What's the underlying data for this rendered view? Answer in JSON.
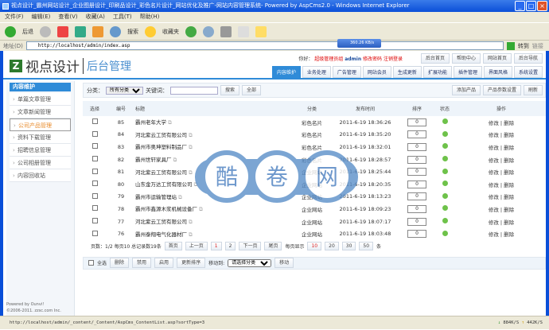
{
  "window": {
    "title": "视点设计_霸州网站设计_企业图册设计_印刷品设计_彩色名片设计_网站优化及推广-网站内容管理系统- Powered by AspCms2.0 - Windows Internet Explorer"
  },
  "menu": [
    "文件(F)",
    "编辑(E)",
    "查看(V)",
    "收藏(A)",
    "工具(T)",
    "帮助(H)"
  ],
  "toolbar": {
    "back": "后退",
    "search": "搜索",
    "favorites": "收藏夹"
  },
  "address": {
    "label": "地址(D)",
    "url": "http://localhost/admin/index.asp",
    "go": "转到",
    "links": "链接",
    "speed": "360.26 KB/s"
  },
  "header": {
    "logo": "视点设计",
    "logo_sub": "后台管理",
    "greeting": "你好：",
    "role": "超级管理员组",
    "user": "admin",
    "change_pwd": "修改密码",
    "logout": "注销登录",
    "top_buttons": [
      "后台首页",
      "帮助中心",
      "网站首页",
      "后台导航"
    ],
    "tabs": [
      "内容维护",
      "业务处理",
      "广告管理",
      "网站会员",
      "生成更新",
      "扩展功能",
      "插件管理",
      "界面风格",
      "系统设置"
    ]
  },
  "sidebar": {
    "title": "内容维护",
    "items": [
      "单篇文章管理",
      "文章新闻管理",
      "公司产品管理",
      "资料下载管理",
      "招聘信息管理",
      "公司相册管理",
      "内容回收站"
    ],
    "footer1": "Powered by Ounvi!",
    "footer2": "©2006-2011. zzsc.com Inc."
  },
  "filter": {
    "category_label": "分类：",
    "category_value": "所有分类",
    "keyword_label": "关键词：",
    "keyword_value": "",
    "search": "搜索",
    "all": "全部",
    "add": "添加产品",
    "params": "产品参数设置",
    "refresh": "刷新"
  },
  "table": {
    "headers": [
      "选择",
      "编号",
      "标题",
      "分类",
      "发布时间",
      "排序",
      "状态",
      "操作"
    ],
    "rows": [
      {
        "id": "85",
        "title": "霸州老年大学",
        "cat": "彩色名片",
        "time": "2011-6-19 18:36:26",
        "order": "0"
      },
      {
        "id": "84",
        "title": "河北紫云工贸有限公司",
        "cat": "彩色名片",
        "time": "2011-6-19 18:35:20",
        "order": "0"
      },
      {
        "id": "83",
        "title": "霸州市奥坤塑料制品厂",
        "cat": "彩色名片",
        "time": "2011-6-19 18:32:01",
        "order": "0"
      },
      {
        "id": "82",
        "title": "霸州世轩家具厂",
        "cat": "彩色名片",
        "time": "2011-6-19 18:28:57",
        "order": "0"
      },
      {
        "id": "81",
        "title": "河北紫云工贸有限公司",
        "cat": "企业网站",
        "time": "2011-6-19 18:25:44",
        "order": "0"
      },
      {
        "id": "80",
        "title": "山东金万达工贸有限公司",
        "cat": "企业网站",
        "time": "2011-6-19 18:20:35",
        "order": "0"
      },
      {
        "id": "79",
        "title": "霸州市运输管理站",
        "cat": "企业网站",
        "time": "2011-6-19 18:13:23",
        "order": "0"
      },
      {
        "id": "78",
        "title": "霸州市鑫源木浆机械设备厂",
        "cat": "企业网站",
        "time": "2011-6-19 18:09:23",
        "order": "0"
      },
      {
        "id": "77",
        "title": "河北紫云工贸有限公司",
        "cat": "企业网站",
        "time": "2011-6-19 18:07:17",
        "order": "0"
      },
      {
        "id": "76",
        "title": "霸州泰翔电气化器材厂",
        "cat": "企业网站",
        "time": "2011-6-19 18:03:48",
        "order": "0"
      }
    ],
    "edit": "修改",
    "delete": "删除"
  },
  "pager": {
    "info": "页数：1/2 每页10 总记录数19条",
    "first": "首页",
    "prev": "上一页",
    "pages": [
      "1",
      "2"
    ],
    "next": "下一页",
    "last": "尾页",
    "per_label": "每页显示",
    "per": [
      "10",
      "20",
      "30",
      "50"
    ],
    "unit": "条"
  },
  "bulk": {
    "select_all": "全选",
    "delete": "删除",
    "disable": "禁用",
    "enable": "启用",
    "update_order": "更新排序",
    "move_to": "移动到:",
    "move_select": "请选择分类",
    "move": "移动"
  },
  "watermark": "酷卷网",
  "status": {
    "url": "http://localhost/admin/_content/_Content/AspCms_ContentList.asp?sortType=3",
    "down": "884K/S",
    "up": "442K/S"
  }
}
